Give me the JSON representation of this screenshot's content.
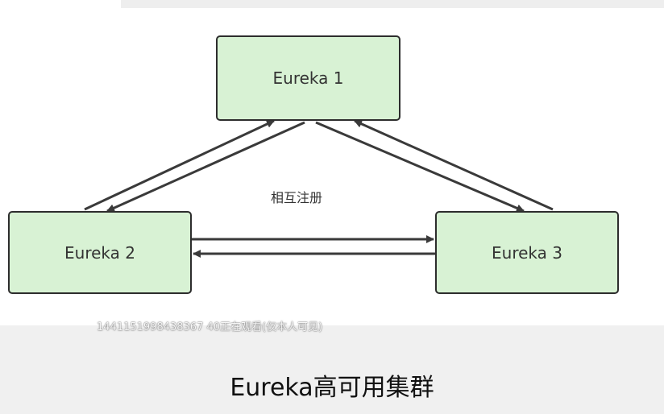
{
  "diagram": {
    "nodes": [
      {
        "id": "eureka-1",
        "label": "Eureka 1"
      },
      {
        "id": "eureka-2",
        "label": "Eureka 2"
      },
      {
        "id": "eureka-3",
        "label": "Eureka 3"
      }
    ],
    "center_label": "相互注册",
    "colors": {
      "node_fill": "#d8f2d4",
      "node_border": "#2d2d2d",
      "arrow": "#3a3a3a"
    }
  },
  "overlay": {
    "watermark": "1441151998438367 40正在观看(仅本人可见)"
  },
  "caption": {
    "title": "Eureka高可用集群"
  }
}
